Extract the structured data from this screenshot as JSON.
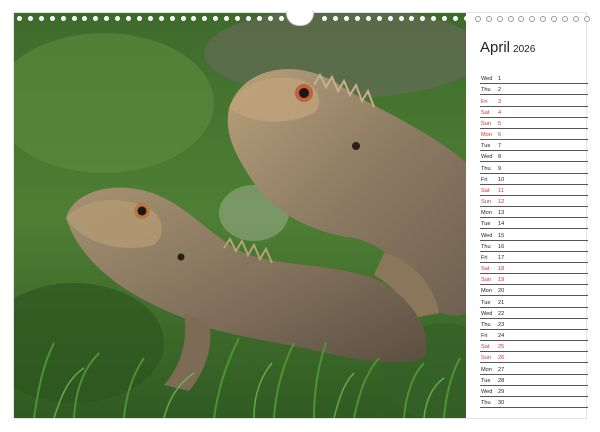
{
  "calendar": {
    "month": "April",
    "year": "2026",
    "days": [
      {
        "name": "Wed",
        "num": "1",
        "weekend": false
      },
      {
        "name": "Thu",
        "num": "2",
        "weekend": false
      },
      {
        "name": "Fri",
        "num": "3",
        "weekend": true
      },
      {
        "name": "Sat",
        "num": "4",
        "weekend": true
      },
      {
        "name": "Sun",
        "num": "5",
        "weekend": true
      },
      {
        "name": "Mon",
        "num": "6",
        "weekend": true
      },
      {
        "name": "Tue",
        "num": "7",
        "weekend": false
      },
      {
        "name": "Wed",
        "num": "8",
        "weekend": false
      },
      {
        "name": "Thu",
        "num": "9",
        "weekend": false
      },
      {
        "name": "Fri",
        "num": "10",
        "weekend": false
      },
      {
        "name": "Sat",
        "num": "11",
        "weekend": true
      },
      {
        "name": "Sun",
        "num": "12",
        "weekend": true
      },
      {
        "name": "Mon",
        "num": "13",
        "weekend": false
      },
      {
        "name": "Tue",
        "num": "14",
        "weekend": false
      },
      {
        "name": "Wed",
        "num": "15",
        "weekend": false
      },
      {
        "name": "Thu",
        "num": "16",
        "weekend": false
      },
      {
        "name": "Fri",
        "num": "17",
        "weekend": false
      },
      {
        "name": "Sat",
        "num": "18",
        "weekend": true
      },
      {
        "name": "Sun",
        "num": "19",
        "weekend": true
      },
      {
        "name": "Mon",
        "num": "20",
        "weekend": false
      },
      {
        "name": "Tue",
        "num": "21",
        "weekend": false
      },
      {
        "name": "Wed",
        "num": "22",
        "weekend": false
      },
      {
        "name": "Thu",
        "num": "23",
        "weekend": false
      },
      {
        "name": "Fri",
        "num": "24",
        "weekend": false
      },
      {
        "name": "Sat",
        "num": "25",
        "weekend": true
      },
      {
        "name": "Sun",
        "num": "26",
        "weekend": true
      },
      {
        "name": "Mon",
        "num": "27",
        "weekend": false
      },
      {
        "name": "Tue",
        "num": "28",
        "weekend": false
      },
      {
        "name": "Wed",
        "num": "29",
        "weekend": false
      },
      {
        "name": "Thu",
        "num": "30",
        "weekend": false
      }
    ]
  },
  "colors": {
    "weekend": "#cc3333",
    "grass": "#3f7a2a",
    "lizard": "#9b8a6e"
  }
}
